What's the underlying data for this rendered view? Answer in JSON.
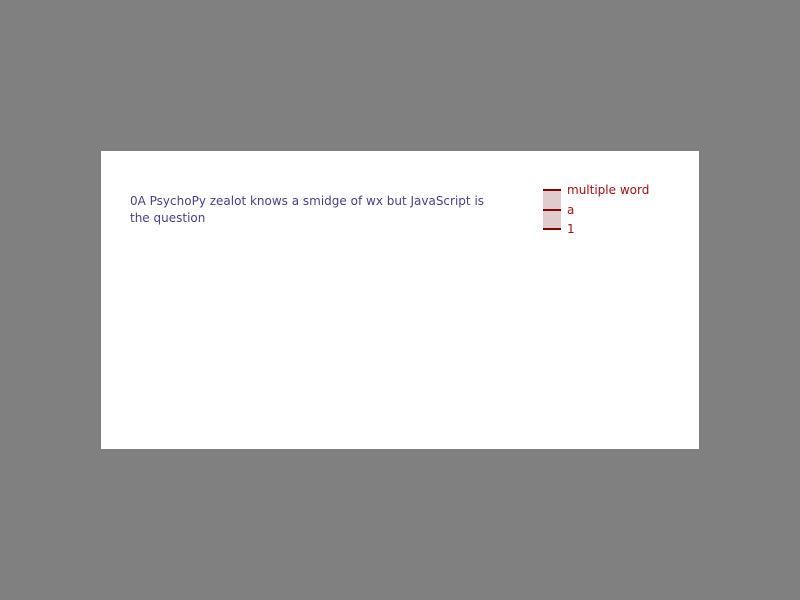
{
  "form": {
    "question": "0A PsychoPy zealot knows a smidge of wx but JavaScript is the question",
    "choices": [
      {
        "label": "multiple word"
      },
      {
        "label": "a"
      },
      {
        "label": "1"
      }
    ]
  },
  "colors": {
    "background": "#808080",
    "panel": "#ffffff",
    "question_text": "#4b3c8c",
    "choice_text": "#a01010",
    "tick": "#8b0000",
    "track": "#e0cccc"
  }
}
